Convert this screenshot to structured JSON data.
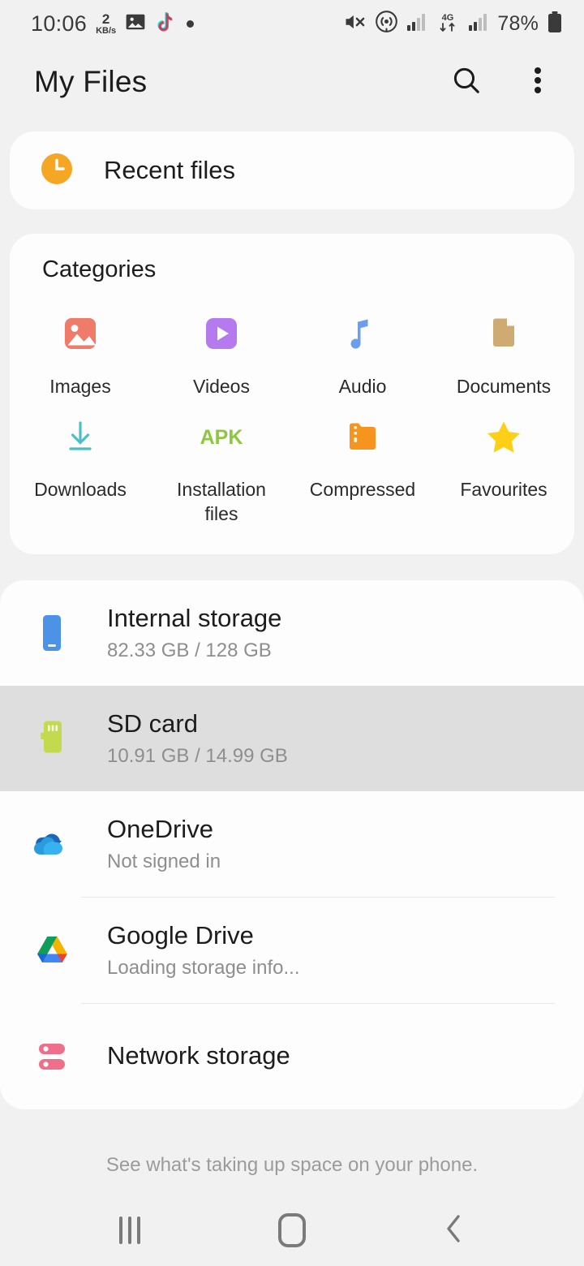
{
  "statusbar": {
    "time": "10:06",
    "speed_value": "2",
    "speed_unit": "KB/s",
    "left_icons": [
      "gallery-icon",
      "tiktok-icon",
      "dot-indicator"
    ],
    "right_icons": [
      "mute-icon",
      "hotspot-icon",
      "signal-bars-icon",
      "network-4g-icon",
      "signal-bars-2-icon"
    ],
    "network_type": "4G",
    "battery_percent": "78%"
  },
  "appbar": {
    "title": "My Files",
    "search_label": "Search",
    "more_label": "More options"
  },
  "recent": {
    "label": "Recent files",
    "icon": "clock-icon",
    "color": "#f5a623"
  },
  "categories": {
    "title": "Categories",
    "items": [
      {
        "label": "Images",
        "icon": "image-icon",
        "color": "#ef7b6b"
      },
      {
        "label": "Videos",
        "icon": "video-play-icon",
        "color": "#b57bee"
      },
      {
        "label": "Audio",
        "icon": "music-note-icon",
        "color": "#6c9ef0"
      },
      {
        "label": "Documents",
        "icon": "document-icon",
        "color": "#cfab74"
      },
      {
        "label": "Downloads",
        "icon": "download-arrow-icon",
        "color": "#4bbfc7"
      },
      {
        "label": "Installation files",
        "icon": "apk-icon",
        "color": "#8dc63f"
      },
      {
        "label": "Compressed",
        "icon": "zip-folder-icon",
        "color": "#f7941e"
      },
      {
        "label": "Favourites",
        "icon": "star-icon",
        "color": "#fdd017"
      }
    ]
  },
  "storage": {
    "items": [
      {
        "name": "Internal storage",
        "sub": "82.33 GB / 128 GB",
        "icon": "phone-icon",
        "color": "#4c93e8",
        "pressed": false,
        "divider": false
      },
      {
        "name": "SD card",
        "sub": "10.91 GB / 14.99 GB",
        "icon": "sd-card-icon",
        "color": "#c3d94e",
        "pressed": true,
        "divider": false
      },
      {
        "name": "OneDrive",
        "sub": "Not signed in",
        "icon": "onedrive-cloud-icon",
        "color": "#1a9bde",
        "pressed": false,
        "divider": true
      },
      {
        "name": "Google Drive",
        "sub": "Loading storage info...",
        "icon": "google-drive-icon",
        "color": "#0f9d58",
        "pressed": false,
        "divider": true
      },
      {
        "name": "Network storage",
        "sub": "",
        "icon": "network-server-icon",
        "color": "#ef6e8a",
        "pressed": false,
        "divider": false
      }
    ]
  },
  "footer": {
    "hint": "See what's taking up space on your phone."
  },
  "navbar": {
    "recents_label": "Recents",
    "home_label": "Home",
    "back_label": "Back"
  }
}
